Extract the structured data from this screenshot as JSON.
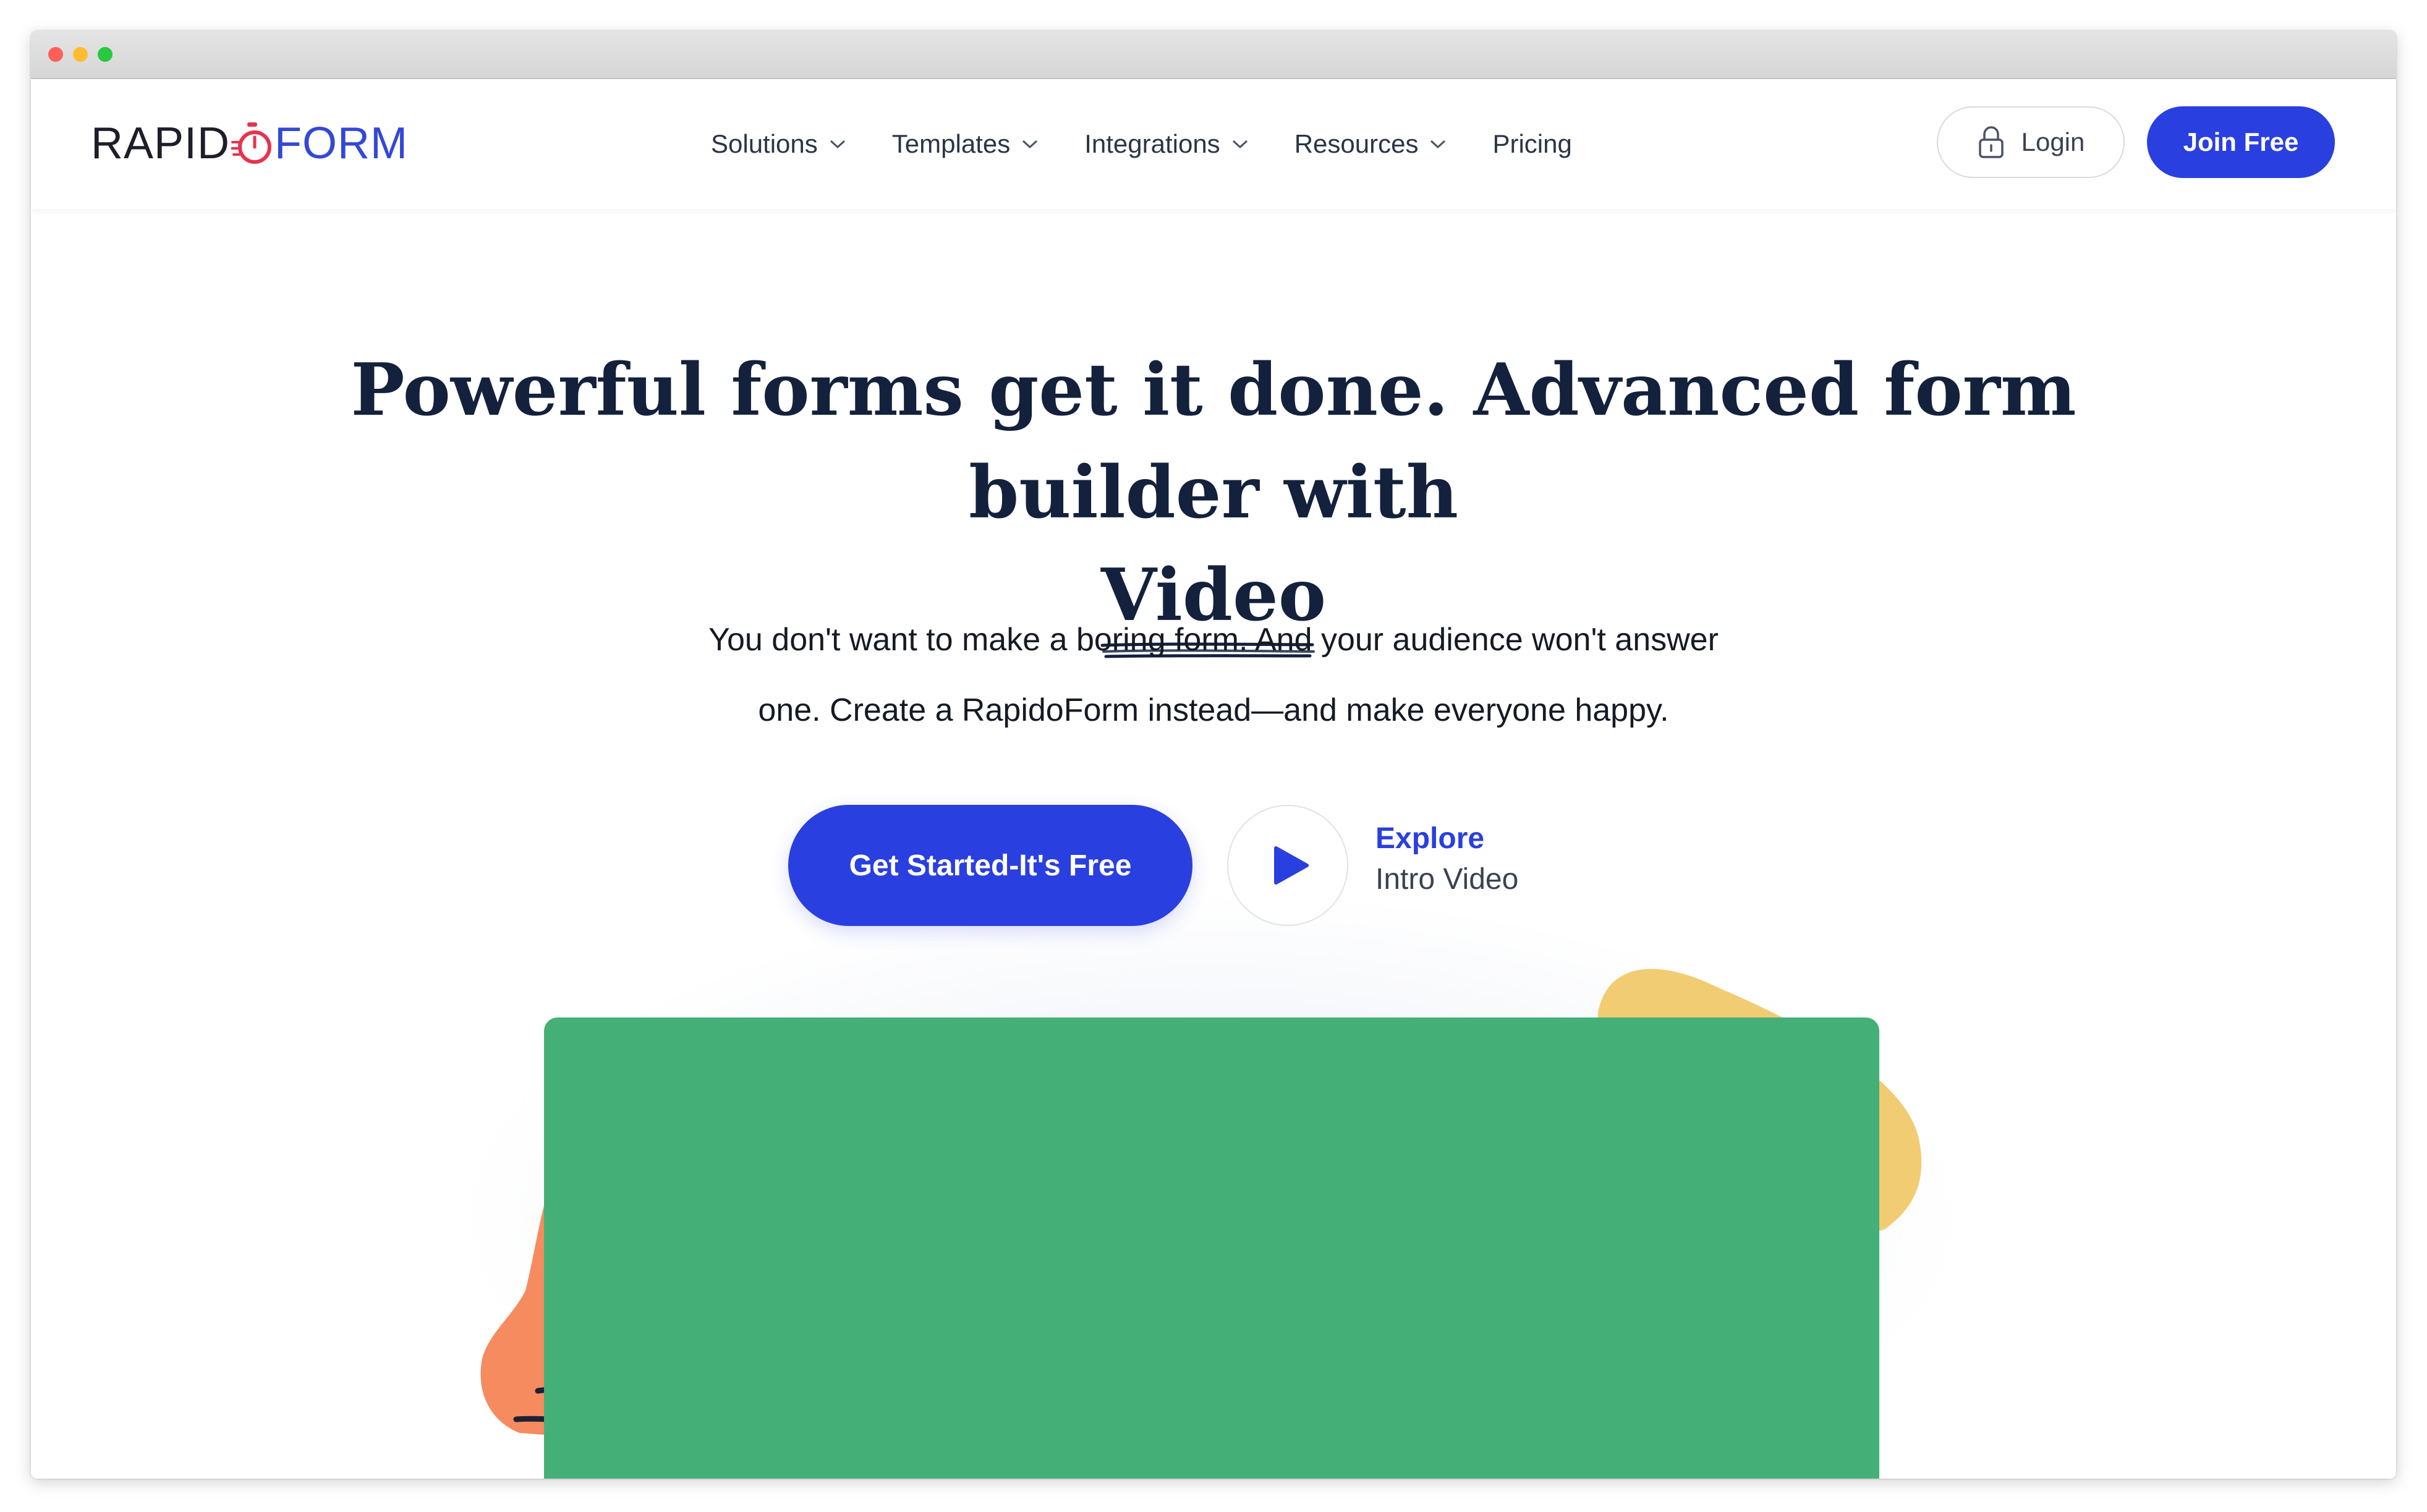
{
  "brand": {
    "logo_left": "RAPID",
    "logo_right": "FORM",
    "primary_color": "#2a3fe0",
    "text_color": "#14213d",
    "logo_accent": "#e8324c"
  },
  "nav": {
    "items": [
      {
        "label": "Solutions",
        "has_dropdown": true
      },
      {
        "label": "Templates",
        "has_dropdown": true
      },
      {
        "label": "Integrations",
        "has_dropdown": true
      },
      {
        "label": "Resources",
        "has_dropdown": true
      },
      {
        "label": "Pricing",
        "has_dropdown": false
      }
    ],
    "login_label": "Login",
    "join_label": "Join Free"
  },
  "hero": {
    "title_line1": "Powerful forms get it done. Advanced form builder with",
    "title_highlight": "Video",
    "subtitle_line1": "You don't want to make a boring form. And your audience won't answer",
    "subtitle_line2": "one. Create a RapidoForm instead—and make everyone happy.",
    "cta_label": "Get Started-It's Free",
    "explore_title": "Explore",
    "explore_sub": "Intro Video"
  },
  "illustration": {
    "card_color": "#44b077",
    "yellow_blob_color": "#f1cc72",
    "orange_blob_color": "#f58b5e"
  }
}
